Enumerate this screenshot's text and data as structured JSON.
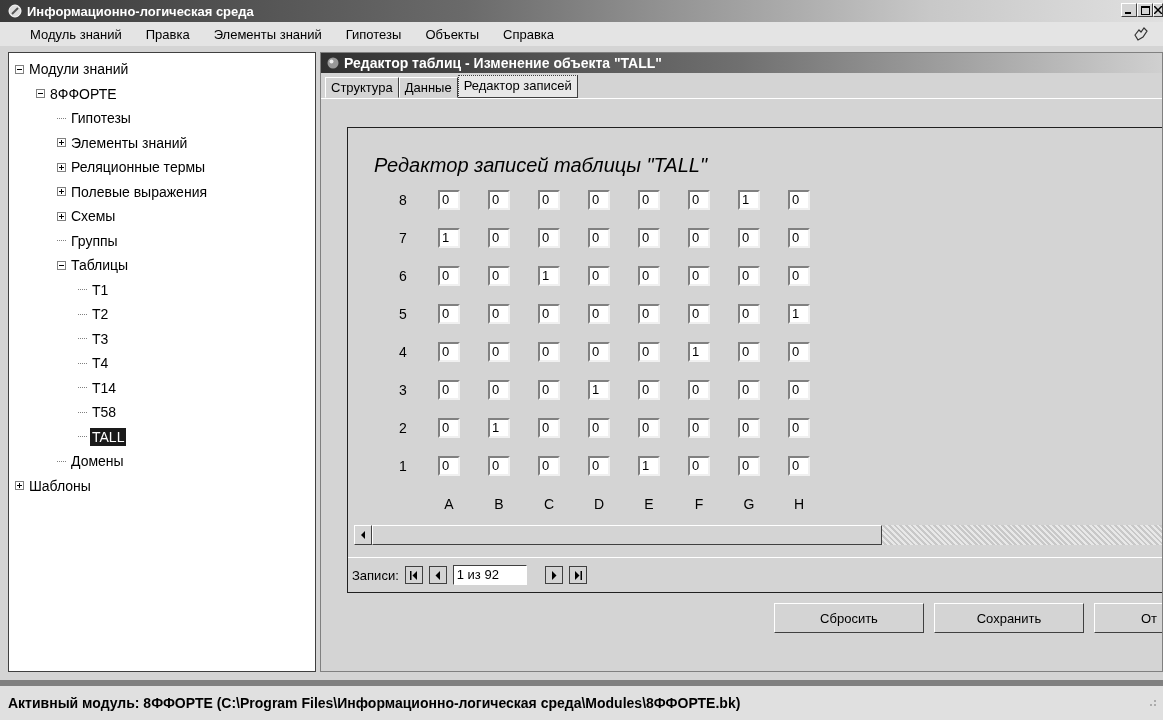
{
  "window": {
    "title": "Информационно-логическая среда"
  },
  "menu": [
    "Модуль знаний",
    "Правка",
    "Элементы знаний",
    "Гипотезы",
    "Объекты",
    "Справка"
  ],
  "tree": [
    {
      "label": "Модули знаний",
      "expanded": true,
      "selected": false,
      "children": [
        {
          "label": "8ФФОРТЕ",
          "expanded": true,
          "selected": false,
          "children": [
            {
              "label": "Гипотезы",
              "selected": false
            },
            {
              "label": "Элементы знаний",
              "expanded": false,
              "selected": false
            },
            {
              "label": "Реляционные термы",
              "expanded": false,
              "selected": false
            },
            {
              "label": "Полевые выражения",
              "expanded": false,
              "selected": false
            },
            {
              "label": "Схемы",
              "expanded": false,
              "selected": false
            },
            {
              "label": "Группы",
              "selected": false
            },
            {
              "label": "Таблицы",
              "expanded": true,
              "selected": false,
              "children": [
                {
                  "label": "T1",
                  "selected": false
                },
                {
                  "label": "T2",
                  "selected": false
                },
                {
                  "label": "T3",
                  "selected": false
                },
                {
                  "label": "T4",
                  "selected": false
                },
                {
                  "label": "T14",
                  "selected": false
                },
                {
                  "label": "T58",
                  "selected": false
                },
                {
                  "label": "TALL",
                  "selected": true
                }
              ]
            },
            {
              "label": "Домены",
              "selected": false
            }
          ]
        }
      ]
    },
    {
      "label": "Шаблоны",
      "expanded": false,
      "selected": false
    }
  ],
  "editor": {
    "title": "Редактор таблиц  -  Изменение объекта \"TALL\"",
    "tabs": [
      {
        "label": "Структура",
        "selected": false
      },
      {
        "label": "Данные",
        "selected": false
      },
      {
        "label": "Редактор записей",
        "selected": true
      }
    ],
    "heading": "Редактор записей таблицы \"TALL\"",
    "rows": [
      {
        "label": "8",
        "cells": [
          "0",
          "0",
          "0",
          "0",
          "0",
          "0",
          "1",
          "0"
        ]
      },
      {
        "label": "7",
        "cells": [
          "1",
          "0",
          "0",
          "0",
          "0",
          "0",
          "0",
          "0"
        ]
      },
      {
        "label": "6",
        "cells": [
          "0",
          "0",
          "1",
          "0",
          "0",
          "0",
          "0",
          "0"
        ]
      },
      {
        "label": "5",
        "cells": [
          "0",
          "0",
          "0",
          "0",
          "0",
          "0",
          "0",
          "1"
        ]
      },
      {
        "label": "4",
        "cells": [
          "0",
          "0",
          "0",
          "0",
          "0",
          "1",
          "0",
          "0"
        ]
      },
      {
        "label": "3",
        "cells": [
          "0",
          "0",
          "0",
          "1",
          "0",
          "0",
          "0",
          "0"
        ]
      },
      {
        "label": "2",
        "cells": [
          "0",
          "1",
          "0",
          "0",
          "0",
          "0",
          "0",
          "0"
        ]
      },
      {
        "label": "1",
        "cells": [
          "0",
          "0",
          "0",
          "0",
          "1",
          "0",
          "0",
          "0"
        ]
      }
    ],
    "column_letters": [
      "A",
      "B",
      "C",
      "D",
      "E",
      "F",
      "G",
      "H"
    ],
    "navigator": {
      "label": "Записи:",
      "position": "1 из 92"
    },
    "buttons": [
      "Сбросить",
      "Сохранить",
      "От"
    ]
  },
  "status_bar": "Активный модуль: 8ФФОРТЕ (C:\\Program Files\\Информационно-логическая среда\\Modules\\8ФФОРТЕ.bk)"
}
